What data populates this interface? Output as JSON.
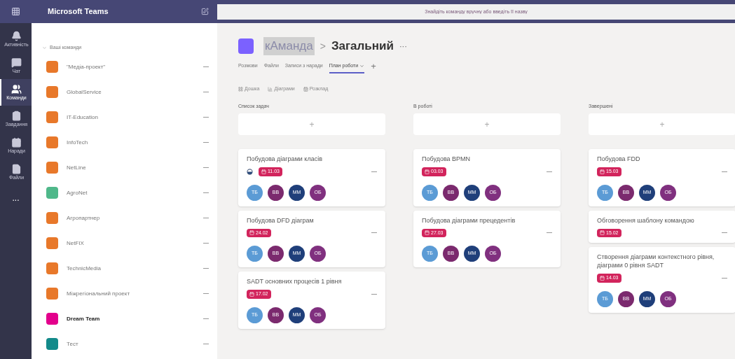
{
  "app": {
    "title": "Microsoft Teams",
    "search": {
      "placeholder": "Знайдіть команду вручну або введіть її назву"
    }
  },
  "rail": [
    {
      "kind": "bell",
      "label": "Активність",
      "selected": false
    },
    {
      "kind": "chat",
      "label": "Чат",
      "selected": false
    },
    {
      "kind": "teams",
      "label": "Команди",
      "selected": true
    },
    {
      "kind": "tasks",
      "label": "Завдання",
      "selected": false
    },
    {
      "kind": "meetings",
      "label": "Наради",
      "selected": false
    },
    {
      "kind": "files",
      "label": "Файли",
      "selected": false
    }
  ],
  "rail_more": "...",
  "teams_header": "Ваші команди",
  "teams": [
    {
      "name": "\"Медіа-проект\"",
      "color": "#e8782a",
      "unread": false
    },
    {
      "name": "GlobalService",
      "color": "#e8782a",
      "unread": false
    },
    {
      "name": "IT-Education",
      "color": "#e8782a",
      "unread": false
    },
    {
      "name": "InfoTech",
      "color": "#e8782a",
      "unread": false
    },
    {
      "name": "NetLine",
      "color": "#e8782a",
      "unread": false
    },
    {
      "name": "AgroNet",
      "color": "#4fb88a",
      "unread": false
    },
    {
      "name": "Агропартнер",
      "color": "#e8782a",
      "unread": false
    },
    {
      "name": "NetFIX",
      "color": "#e8782a",
      "unread": false
    },
    {
      "name": "TechnicMedia",
      "color": "#e8782a",
      "unread": false
    },
    {
      "name": "Міжрегіональний проект",
      "color": "#e8782a",
      "unread": false
    },
    {
      "name": "Dream Team",
      "color": "#e3008c",
      "unread": true
    },
    {
      "name": "Тест",
      "color": "#138a8a",
      "unread": false
    }
  ],
  "channel": {
    "team": "кАманда",
    "separator": ">",
    "name": "Загальний",
    "more": "···"
  },
  "tabs": [
    {
      "label": "Розмови",
      "selected": false
    },
    {
      "label": "Файли",
      "selected": false
    },
    {
      "label": "Записи з наради",
      "selected": false
    },
    {
      "label": "План роботи",
      "selected": true
    }
  ],
  "add_tab": "+",
  "views": [
    {
      "kind": "board",
      "label": "Дошка"
    },
    {
      "kind": "charts",
      "label": "Діаграми"
    },
    {
      "kind": "schedule",
      "label": "Розклад"
    }
  ],
  "columns": [
    {
      "title": "Список задач",
      "add": "+",
      "tasks": [
        {
          "title": "Побудова діаграми класів",
          "started": true,
          "due": "11.03",
          "members": [
            {
              "initials": "ТБ",
              "color": "#5b9bd5"
            },
            {
              "initials": "ВВ",
              "color": "#7b2a6e"
            },
            {
              "initials": "ММ",
              "color": "#1f3f7a"
            },
            {
              "initials": "ОБ",
              "color": "#80307f"
            }
          ]
        },
        {
          "title": "Побудова DFD діаграм",
          "started": false,
          "due": "24.02",
          "members": [
            {
              "initials": "ТБ",
              "color": "#5b9bd5"
            },
            {
              "initials": "ВВ",
              "color": "#7b2a6e"
            },
            {
              "initials": "ММ",
              "color": "#1f3f7a"
            },
            {
              "initials": "ОБ",
              "color": "#80307f"
            }
          ]
        },
        {
          "title": "SADT основних процесів 1 рівня",
          "started": false,
          "due": "17.02",
          "members": [
            {
              "initials": "ТБ",
              "color": "#5b9bd5"
            },
            {
              "initials": "ВВ",
              "color": "#7b2a6e"
            },
            {
              "initials": "ММ",
              "color": "#1f3f7a"
            },
            {
              "initials": "ОБ",
              "color": "#80307f"
            }
          ]
        }
      ]
    },
    {
      "title": "В роботі",
      "add": "+",
      "tasks": [
        {
          "title": "Побудова BPMN",
          "started": false,
          "due": "03.03",
          "members": [
            {
              "initials": "ТБ",
              "color": "#5b9bd5"
            },
            {
              "initials": "ВВ",
              "color": "#7b2a6e"
            },
            {
              "initials": "ММ",
              "color": "#1f3f7a"
            },
            {
              "initials": "ОБ",
              "color": "#80307f"
            }
          ]
        },
        {
          "title": "Побудова діаграми прецедентів",
          "started": false,
          "due": "27.03",
          "members": [
            {
              "initials": "ТБ",
              "color": "#5b9bd5"
            },
            {
              "initials": "ВВ",
              "color": "#7b2a6e"
            },
            {
              "initials": "ММ",
              "color": "#1f3f7a"
            },
            {
              "initials": "ОБ",
              "color": "#80307f"
            }
          ]
        }
      ]
    },
    {
      "title": "Завершені",
      "add": "+",
      "tasks": [
        {
          "title": "Побудова FDD",
          "started": false,
          "due": "15.03",
          "members": [
            {
              "initials": "ТБ",
              "color": "#5b9bd5"
            },
            {
              "initials": "ВВ",
              "color": "#7b2a6e"
            },
            {
              "initials": "ММ",
              "color": "#1f3f7a"
            },
            {
              "initials": "ОБ",
              "color": "#80307f"
            }
          ]
        },
        {
          "title": "Обговорення шаблону командою",
          "started": false,
          "due": "15.02"
        },
        {
          "title": "Створення діаграми контекстного рівня, діаграми 0 рівня SADT",
          "started": false,
          "due": "14.03",
          "members": [
            {
              "initials": "ТБ",
              "color": "#5b9bd5"
            },
            {
              "initials": "ВВ",
              "color": "#7b2a6e"
            },
            {
              "initials": "ММ",
              "color": "#1f3f7a"
            },
            {
              "initials": "ОБ",
              "color": "#80307f"
            }
          ]
        }
      ]
    }
  ]
}
